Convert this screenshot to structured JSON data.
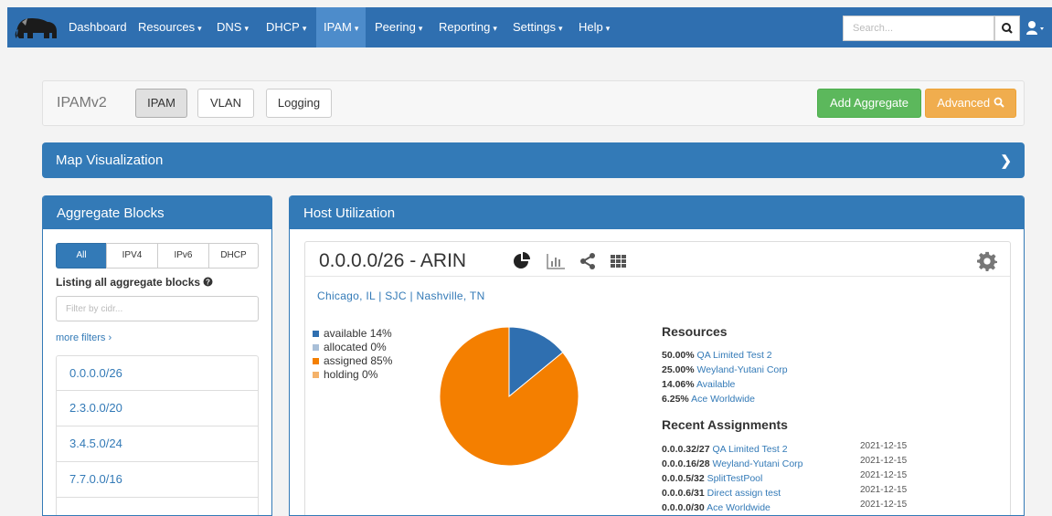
{
  "nav": {
    "items": [
      {
        "label": "Dashboard",
        "caret": ""
      },
      {
        "label": "Resources",
        "caret": "▾"
      },
      {
        "label": "DNS",
        "caret": "▾"
      },
      {
        "label": "DHCP",
        "caret": "▾"
      },
      {
        "label": "IPAM",
        "caret": "▾"
      },
      {
        "label": "Peering",
        "caret": "▾"
      },
      {
        "label": "Reporting",
        "caret": "▾"
      },
      {
        "label": "Settings",
        "caret": "▾"
      },
      {
        "label": "Help",
        "caret": "▾"
      }
    ],
    "active": "IPAM",
    "search_placeholder": "Search..."
  },
  "ipam_bar": {
    "title": "IPAMv2",
    "tabs": [
      "IPAM",
      "VLAN",
      "Logging"
    ],
    "add_aggregate": "Add Aggregate",
    "advanced": "Advanced"
  },
  "map": {
    "title": "Map Visualization"
  },
  "aggregate": {
    "title": "Aggregate Blocks",
    "filters": [
      "All",
      "IPV4",
      "IPv6",
      "DHCP"
    ],
    "listing": "Listing all aggregate blocks",
    "filter_placeholder": "Filter by cidr...",
    "more_filters": "more filters",
    "blocks": [
      "0.0.0.0/26",
      "2.3.0.0/20",
      "3.4.5.0/24",
      "7.7.0.0/16",
      ""
    ]
  },
  "host": {
    "title": "Host Utilization",
    "block": "0.0.0.0/26 - ARIN",
    "locations": "Chicago, IL | SJC | Nashville, TN",
    "legend": [
      {
        "label": "available 14%",
        "color": "#2f6fb0"
      },
      {
        "label": "allocated 0%",
        "color": "#a9bfd8"
      },
      {
        "label": "assigned 85%",
        "color": "#f47f00"
      },
      {
        "label": "holding 0%",
        "color": "#f4b26a"
      }
    ],
    "pie": {
      "available": 14.06,
      "assigned": 85.94
    },
    "resources_title": "Resources",
    "resources": [
      {
        "pct": "50.00%",
        "name": "QA Limited Test 2"
      },
      {
        "pct": "25.00%",
        "name": "Weyland-Yutani Corp"
      },
      {
        "pct": "14.06%",
        "name": "Available"
      },
      {
        "pct": "6.25%",
        "name": "Ace  Worldwide"
      }
    ],
    "recent_title": "Recent Assignments",
    "recent": [
      {
        "cidr": "0.0.0.32/27",
        "name": "QA Limited Test 2",
        "date": "2021-12-15"
      },
      {
        "cidr": "0.0.0.16/28",
        "name": "Weyland-Yutani Corp",
        "date": "2021-12-15"
      },
      {
        "cidr": "0.0.0.5/32",
        "name": "SplitTestPool",
        "date": "2021-12-15"
      },
      {
        "cidr": "0.0.0.6/31",
        "name": "Direct assign test",
        "date": "2021-12-15"
      },
      {
        "cidr": "0.0.0.0/30",
        "name": "Ace  Worldwide",
        "date": "2021-12-15"
      }
    ]
  }
}
